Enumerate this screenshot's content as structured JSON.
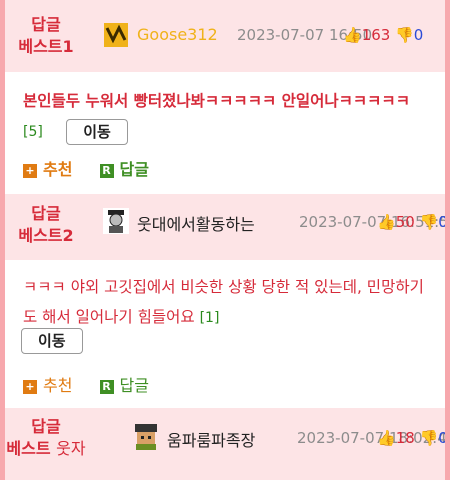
{
  "posts": [
    {
      "badge_line1": "답글",
      "badge_line2": "베스트1",
      "nickname": "Goose312",
      "nickname_color": "#f0b21a",
      "date": "2023-07-07 16:50",
      "upvotes": "163",
      "downvotes": "0",
      "content": "본인들두 누워서 빵터졌나봐ㅋㅋㅋㅋㅋ 안일어나ㅋㅋㅋㅋㅋ",
      "reply_count": "[5]",
      "move_label": "이동",
      "recommend_label": "추천",
      "reply_label": "답글"
    },
    {
      "badge_line1": "답글",
      "badge_line2": "베스트2",
      "nickname": "웃대에서활동하는",
      "nickname_color": "#222222",
      "date": "2023-07-07 16:51:52",
      "upvotes": "50",
      "downvotes": "0",
      "content": "ㅋㅋㅋ 야외 고깃집에서 비슷한 상황 당한 적 있는데, 민망하기도 해서 일어나기 힘들어요",
      "reply_count": "[1]",
      "move_label": "이동",
      "recommend_label": "추천",
      "reply_label": "답글"
    },
    {
      "badge_line1": "답글",
      "badge_line2": "베스트",
      "badge_sub": "웃자",
      "nickname": "움파룸파족장",
      "nickname_color": "#222222",
      "date": "2023-07-07 18:02:45",
      "upvotes": "18",
      "downvotes": "0"
    }
  ],
  "colors": {
    "accent": "#d62b3a",
    "header_bg": "#fde4e6",
    "frame": "#f7a8ad"
  }
}
